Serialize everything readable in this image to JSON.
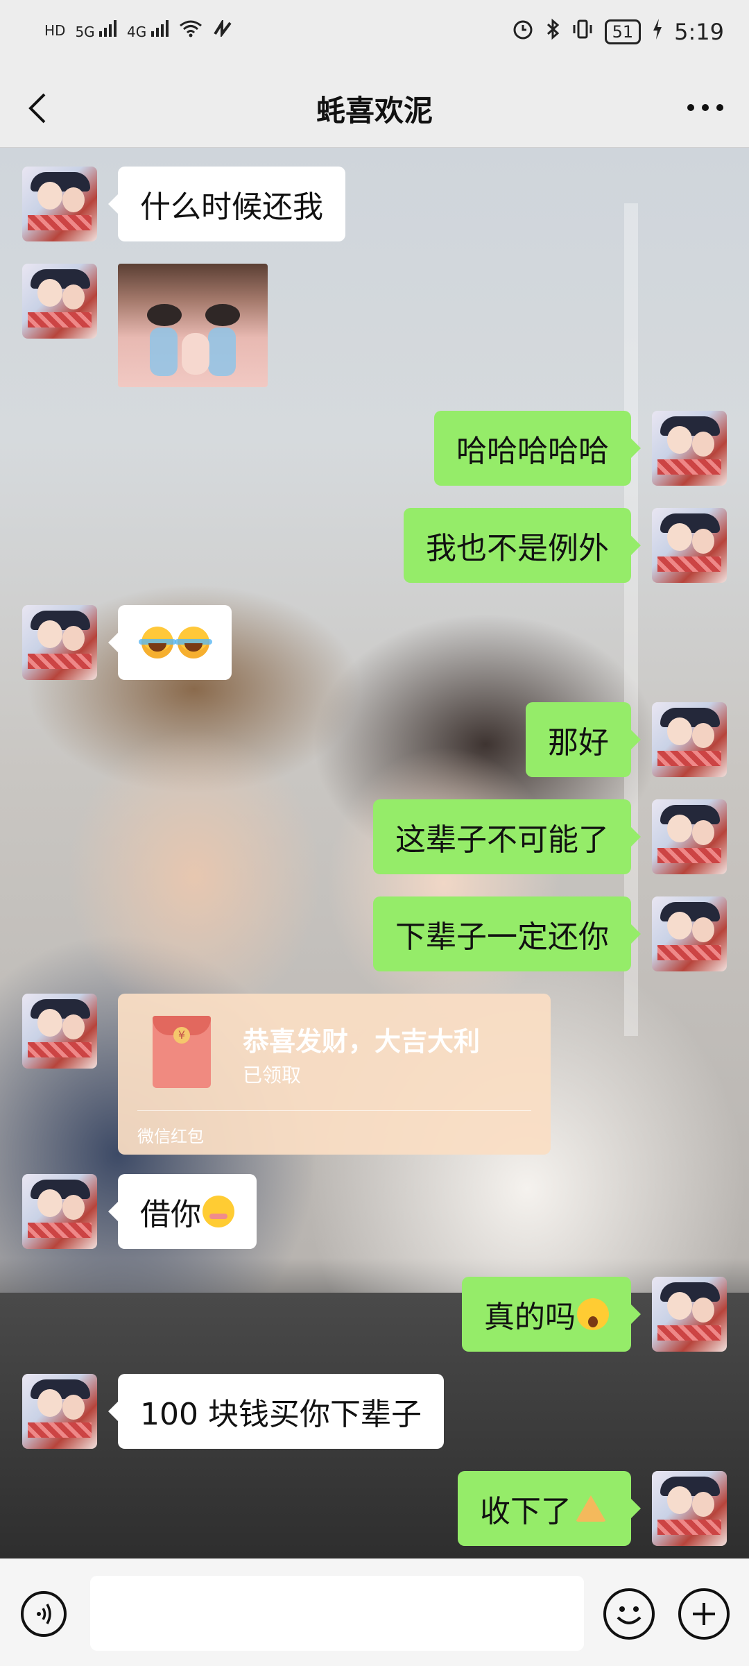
{
  "status_bar": {
    "left_indicators": [
      "HD",
      "5G",
      "4G"
    ],
    "battery": "51",
    "time": "5:19"
  },
  "header": {
    "title": "蚝喜欢泥"
  },
  "messages": [
    {
      "side": "in",
      "type": "text",
      "text": "什么时候还我"
    },
    {
      "side": "in",
      "type": "sticker",
      "sticker": "crying-girl"
    },
    {
      "side": "out",
      "type": "text",
      "text": "哈哈哈哈哈"
    },
    {
      "side": "out",
      "type": "text",
      "text": "我也不是例外"
    },
    {
      "side": "in",
      "type": "emoji",
      "emoji": [
        "laugh-cry-emoji",
        "laugh-cry-emoji"
      ]
    },
    {
      "side": "out",
      "type": "text",
      "text": "那好"
    },
    {
      "side": "out",
      "type": "text",
      "text": "这辈子不可能了"
    },
    {
      "side": "out",
      "type": "text",
      "text": "下辈子一定还你"
    },
    {
      "side": "in",
      "type": "red_packet",
      "title": "恭喜发财，大吉大利",
      "status": "已领取",
      "footer": "微信红包"
    },
    {
      "side": "in",
      "type": "text",
      "text": "借你",
      "emoji": "shy-emoji"
    },
    {
      "side": "out",
      "type": "text",
      "text": "真的吗",
      "emoji": "surprised-emoji"
    },
    {
      "side": "in",
      "type": "text",
      "text": "100 块钱买你下辈子"
    },
    {
      "side": "out",
      "type": "text",
      "text": "收下了",
      "emoji": "pray-emoji"
    }
  ],
  "input_bar": {
    "placeholder": ""
  },
  "colors": {
    "outgoing_bubble": "#95ec69",
    "incoming_bubble": "#ffffff",
    "bar_background": "#ededed",
    "red_packet": "#fadec4"
  }
}
